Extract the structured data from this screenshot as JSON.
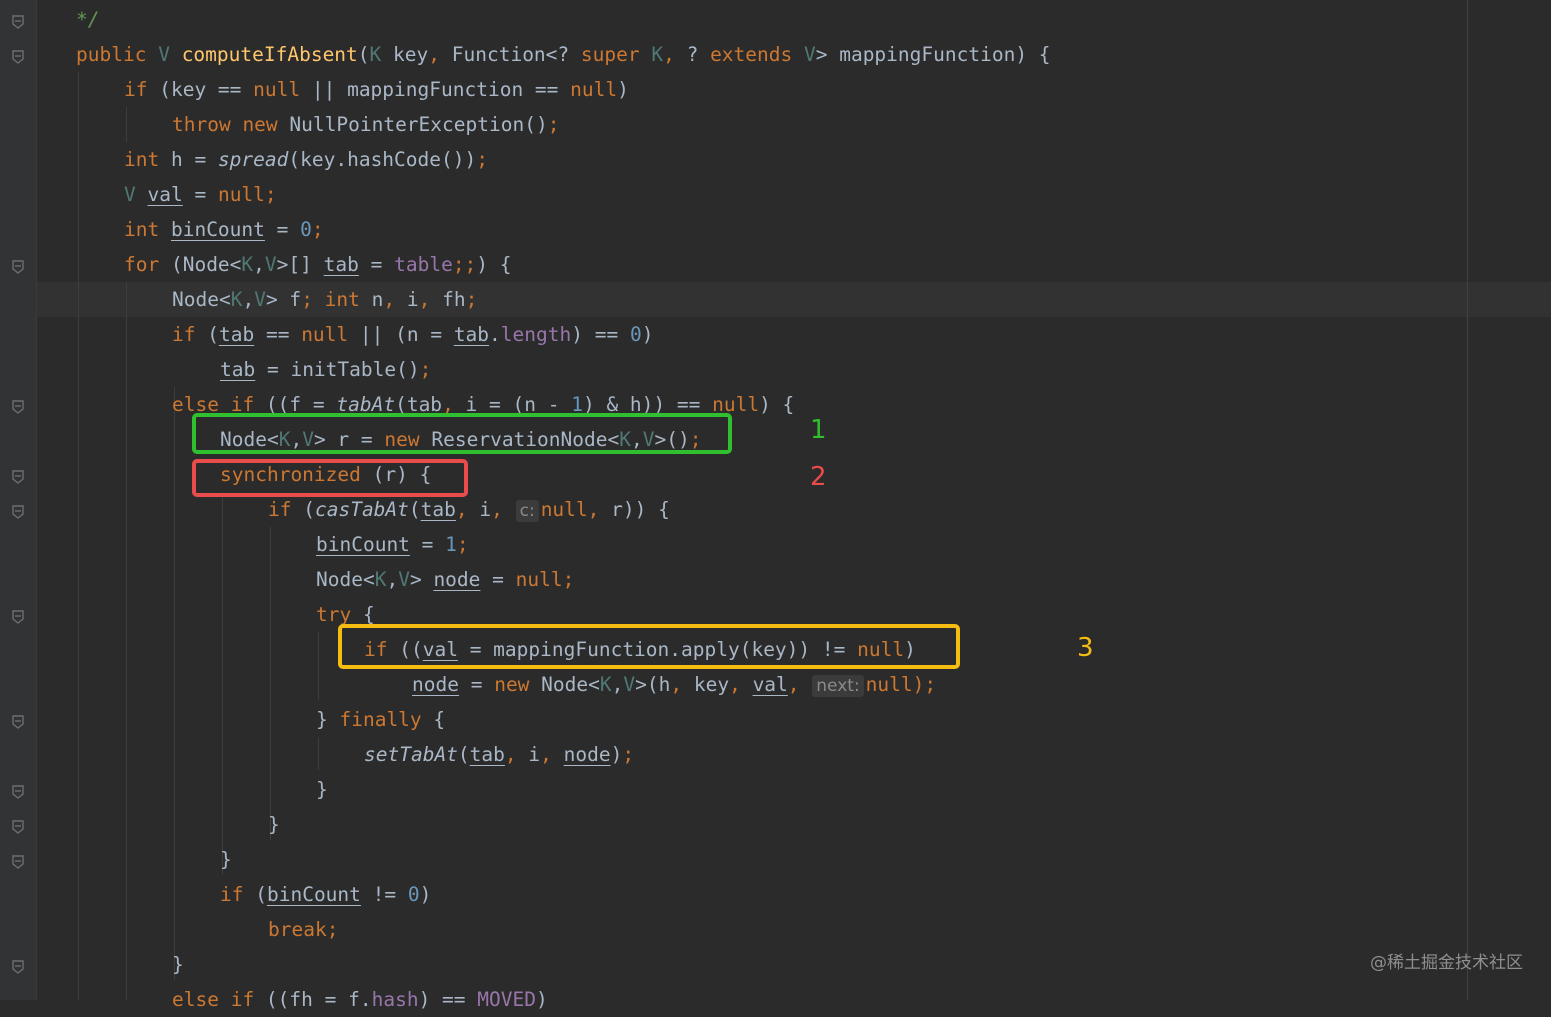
{
  "editor": {
    "colors": {
      "background": "#2b2b2b",
      "keyword": "#cc7832",
      "type_param": "#507874",
      "method_decl": "#ffc66d",
      "number": "#6897bb",
      "field": "#9876aa",
      "text": "#a9b7c6"
    },
    "lines": [
      {
        "id": "line-01",
        "indent": 1,
        "segments": [
          {
            "t": "*/",
            "c": "cm"
          }
        ]
      },
      {
        "id": "line-02",
        "indent": 1,
        "segments": [
          {
            "t": "public ",
            "c": "kw"
          },
          {
            "t": "V",
            "c": "tp"
          },
          {
            "t": " "
          },
          {
            "t": "computeIfAbsent",
            "c": "fn"
          },
          {
            "t": "("
          },
          {
            "t": "K",
            "c": "tp"
          },
          {
            "t": " key"
          },
          {
            "t": ", ",
            "c": "kw"
          },
          {
            "t": "Function<? "
          },
          {
            "t": "super ",
            "c": "kw"
          },
          {
            "t": "K",
            "c": "tp"
          },
          {
            "t": ", ",
            "c": "kw"
          },
          {
            "t": "? "
          },
          {
            "t": "extends ",
            "c": "kw"
          },
          {
            "t": "V",
            "c": "tp"
          },
          {
            "t": "> mappingFunction) {"
          }
        ]
      },
      {
        "id": "line-03",
        "indent": 2,
        "segments": [
          {
            "t": "if ",
            "c": "kw"
          },
          {
            "t": "(key == "
          },
          {
            "t": "null ",
            "c": "kw"
          },
          {
            "t": "|| mappingFunction == "
          },
          {
            "t": "null",
            "c": "kw"
          },
          {
            "t": ")"
          }
        ]
      },
      {
        "id": "line-04",
        "indent": 3,
        "segments": [
          {
            "t": "throw new ",
            "c": "kw"
          },
          {
            "t": "NullPointerException()"
          },
          {
            "t": ";",
            "c": "kw"
          }
        ]
      },
      {
        "id": "line-05",
        "indent": 2,
        "segments": [
          {
            "t": "int ",
            "c": "kw"
          },
          {
            "t": "h = "
          },
          {
            "t": "spread",
            "c": "it"
          },
          {
            "t": "(key.hashCode())"
          },
          {
            "t": ";",
            "c": "kw"
          }
        ]
      },
      {
        "id": "line-06",
        "indent": 2,
        "segments": [
          {
            "t": "V ",
            "c": "tp"
          },
          {
            "t": "val",
            "c": "ul"
          },
          {
            "t": " = "
          },
          {
            "t": "null;",
            "c": "kw"
          }
        ]
      },
      {
        "id": "line-07",
        "indent": 2,
        "segments": [
          {
            "t": "int ",
            "c": "kw"
          },
          {
            "t": "binCount",
            "c": "ul"
          },
          {
            "t": " = "
          },
          {
            "t": "0",
            "c": "num"
          },
          {
            "t": ";",
            "c": "kw"
          }
        ]
      },
      {
        "id": "line-08",
        "indent": 2,
        "segments": [
          {
            "t": "for ",
            "c": "kw"
          },
          {
            "t": "(Node<"
          },
          {
            "t": "K",
            "c": "tp"
          },
          {
            "t": ","
          },
          {
            "t": "V",
            "c": "tp"
          },
          {
            "t": ">[] "
          },
          {
            "t": "tab",
            "c": "ul"
          },
          {
            "t": " = "
          },
          {
            "t": "table",
            "c": "fld"
          },
          {
            "t": ";;",
            "c": "kw"
          },
          {
            "t": ") {"
          }
        ]
      },
      {
        "id": "line-09",
        "indent": 3,
        "segments": [
          {
            "t": "Node<"
          },
          {
            "t": "K",
            "c": "tp"
          },
          {
            "t": ","
          },
          {
            "t": "V",
            "c": "tp"
          },
          {
            "t": "> f"
          },
          {
            "t": "; int ",
            "c": "kw"
          },
          {
            "t": "n"
          },
          {
            "t": ", ",
            "c": "kw"
          },
          {
            "t": "i"
          },
          {
            "t": ", ",
            "c": "kw"
          },
          {
            "t": "fh"
          },
          {
            "t": ";",
            "c": "kw"
          }
        ]
      },
      {
        "id": "line-10",
        "indent": 3,
        "segments": [
          {
            "t": "if ",
            "c": "kw"
          },
          {
            "t": "("
          },
          {
            "t": "tab",
            "c": "ul"
          },
          {
            "t": " == "
          },
          {
            "t": "null ",
            "c": "kw"
          },
          {
            "t": "|| (n = "
          },
          {
            "t": "tab",
            "c": "ul"
          },
          {
            "t": "."
          },
          {
            "t": "length",
            "c": "fld"
          },
          {
            "t": ") == "
          },
          {
            "t": "0",
            "c": "num"
          },
          {
            "t": ")"
          }
        ]
      },
      {
        "id": "line-11",
        "indent": 4,
        "segments": [
          {
            "t": "tab",
            "c": "ul"
          },
          {
            "t": " = initTable()"
          },
          {
            "t": ";",
            "c": "kw"
          }
        ]
      },
      {
        "id": "line-12",
        "indent": 3,
        "segments": [
          {
            "t": "else if ",
            "c": "kw"
          },
          {
            "t": "((f = "
          },
          {
            "t": "tabAt",
            "c": "it"
          },
          {
            "t": "("
          },
          {
            "t": "tab",
            "c": "ul"
          },
          {
            "t": ", ",
            "c": "kw"
          },
          {
            "t": "i = (n - "
          },
          {
            "t": "1",
            "c": "num"
          },
          {
            "t": ") & h)) == "
          },
          {
            "t": "null",
            "c": "kw"
          },
          {
            "t": ") {"
          }
        ]
      },
      {
        "id": "line-13",
        "indent": 4,
        "segments": [
          {
            "t": "Node<"
          },
          {
            "t": "K",
            "c": "tp"
          },
          {
            "t": ","
          },
          {
            "t": "V",
            "c": "tp"
          },
          {
            "t": "> r = "
          },
          {
            "t": "new ",
            "c": "kw"
          },
          {
            "t": "ReservationNode<"
          },
          {
            "t": "K",
            "c": "tp"
          },
          {
            "t": ","
          },
          {
            "t": "V",
            "c": "tp"
          },
          {
            "t": ">()"
          },
          {
            "t": ";",
            "c": "kw"
          }
        ]
      },
      {
        "id": "line-14",
        "indent": 4,
        "segments": [
          {
            "t": "synchronized ",
            "c": "kw"
          },
          {
            "t": "(r) {"
          }
        ]
      },
      {
        "id": "line-15",
        "indent": 5,
        "segments": [
          {
            "t": "if ",
            "c": "kw"
          },
          {
            "t": "("
          },
          {
            "t": "casTabAt",
            "c": "it"
          },
          {
            "t": "("
          },
          {
            "t": "tab",
            "c": "ul"
          },
          {
            "t": ", ",
            "c": "kw"
          },
          {
            "t": "i"
          },
          {
            "t": ", ",
            "c": "kw"
          },
          {
            "t": "c:",
            "c": "hint"
          },
          {
            "t": "null",
            "c": "kw"
          },
          {
            "t": ", ",
            "c": "kw"
          },
          {
            "t": "r)) {"
          }
        ]
      },
      {
        "id": "line-16",
        "indent": 6,
        "segments": [
          {
            "t": "binCount",
            "c": "ul"
          },
          {
            "t": " = "
          },
          {
            "t": "1",
            "c": "num"
          },
          {
            "t": ";",
            "c": "kw"
          }
        ]
      },
      {
        "id": "line-17",
        "indent": 6,
        "segments": [
          {
            "t": "Node<"
          },
          {
            "t": "K",
            "c": "tp"
          },
          {
            "t": ","
          },
          {
            "t": "V",
            "c": "tp"
          },
          {
            "t": "> "
          },
          {
            "t": "node",
            "c": "ul"
          },
          {
            "t": " = "
          },
          {
            "t": "null;",
            "c": "kw"
          }
        ]
      },
      {
        "id": "line-18",
        "indent": 6,
        "segments": [
          {
            "t": "try ",
            "c": "kw"
          },
          {
            "t": "{"
          }
        ]
      },
      {
        "id": "line-19",
        "indent": 7,
        "segments": [
          {
            "t": "if ",
            "c": "kw"
          },
          {
            "t": "(("
          },
          {
            "t": "val",
            "c": "ul"
          },
          {
            "t": " = mappingFunction.apply(key)) != "
          },
          {
            "t": "null",
            "c": "kw"
          },
          {
            "t": ")"
          }
        ]
      },
      {
        "id": "line-20",
        "indent": 8,
        "segments": [
          {
            "t": "node",
            "c": "ul"
          },
          {
            "t": " = "
          },
          {
            "t": "new ",
            "c": "kw"
          },
          {
            "t": "Node<"
          },
          {
            "t": "K",
            "c": "tp"
          },
          {
            "t": ","
          },
          {
            "t": "V",
            "c": "tp"
          },
          {
            "t": ">(h"
          },
          {
            "t": ", ",
            "c": "kw"
          },
          {
            "t": "key"
          },
          {
            "t": ", ",
            "c": "kw"
          },
          {
            "t": "val",
            "c": "ul"
          },
          {
            "t": ", ",
            "c": "kw"
          },
          {
            "t": "next:",
            "c": "hint"
          },
          {
            "t": "null",
            "c": "kw"
          },
          {
            "t": ");",
            "c": "kw"
          }
        ]
      },
      {
        "id": "line-21",
        "indent": 6,
        "segments": [
          {
            "t": "} "
          },
          {
            "t": "finally ",
            "c": "kw"
          },
          {
            "t": "{"
          }
        ]
      },
      {
        "id": "line-22",
        "indent": 7,
        "segments": [
          {
            "t": "setTabAt",
            "c": "it"
          },
          {
            "t": "("
          },
          {
            "t": "tab",
            "c": "ul"
          },
          {
            "t": ", ",
            "c": "kw"
          },
          {
            "t": "i"
          },
          {
            "t": ", ",
            "c": "kw"
          },
          {
            "t": "node",
            "c": "ul"
          },
          {
            "t": ")"
          },
          {
            "t": ";",
            "c": "kw"
          }
        ]
      },
      {
        "id": "line-23",
        "indent": 6,
        "segments": [
          {
            "t": "}"
          }
        ]
      },
      {
        "id": "line-24",
        "indent": 5,
        "segments": [
          {
            "t": "}"
          }
        ]
      },
      {
        "id": "line-25",
        "indent": 4,
        "segments": [
          {
            "t": "}"
          }
        ]
      },
      {
        "id": "line-26",
        "indent": 4,
        "segments": [
          {
            "t": "if ",
            "c": "kw"
          },
          {
            "t": "("
          },
          {
            "t": "binCount",
            "c": "ul"
          },
          {
            "t": " != "
          },
          {
            "t": "0",
            "c": "num"
          },
          {
            "t": ")"
          }
        ]
      },
      {
        "id": "line-27",
        "indent": 5,
        "segments": [
          {
            "t": "break;",
            "c": "kw"
          }
        ]
      },
      {
        "id": "line-28",
        "indent": 3,
        "segments": [
          {
            "t": "}"
          }
        ]
      },
      {
        "id": "line-29",
        "indent": 3,
        "segments": [
          {
            "t": "else if ",
            "c": "kw"
          },
          {
            "t": "((fh = f."
          },
          {
            "t": "hash",
            "c": "fld"
          },
          {
            "t": ") == "
          },
          {
            "t": "MOVED",
            "c": "fld"
          },
          {
            "t": ")"
          }
        ]
      }
    ]
  },
  "annotations": [
    {
      "id": "annotation-box-1",
      "label": "1",
      "color": "#2fbf2f"
    },
    {
      "id": "annotation-box-2",
      "label": "2",
      "color": "#ea4b4b"
    },
    {
      "id": "annotation-box-3",
      "label": "3",
      "color": "#f5bc12"
    }
  ],
  "watermark": "@稀土掘金技术社区"
}
